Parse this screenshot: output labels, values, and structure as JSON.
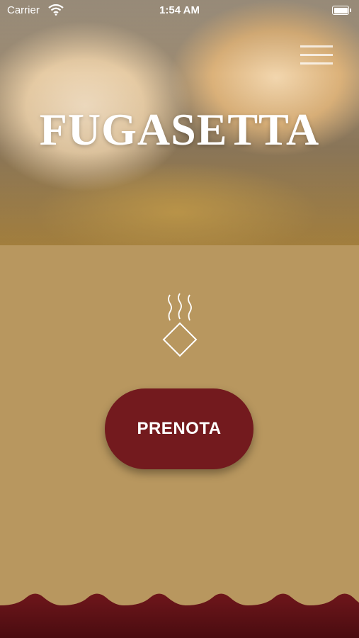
{
  "status_bar": {
    "carrier": "Carrier",
    "time": "1:54 AM",
    "wifi_icon": "wifi-icon",
    "battery_icon": "battery-icon"
  },
  "header": {
    "title": "FUGASETTA",
    "menu_icon": "hamburger-menu-icon"
  },
  "logo": {
    "icon": "steaming-diamond-icon"
  },
  "actions": {
    "book_label": "PRENOTA"
  },
  "colors": {
    "background": "#b8975f",
    "button": "#731a1e",
    "footer_wave": "#5e1116",
    "text_light": "#ffffff"
  }
}
